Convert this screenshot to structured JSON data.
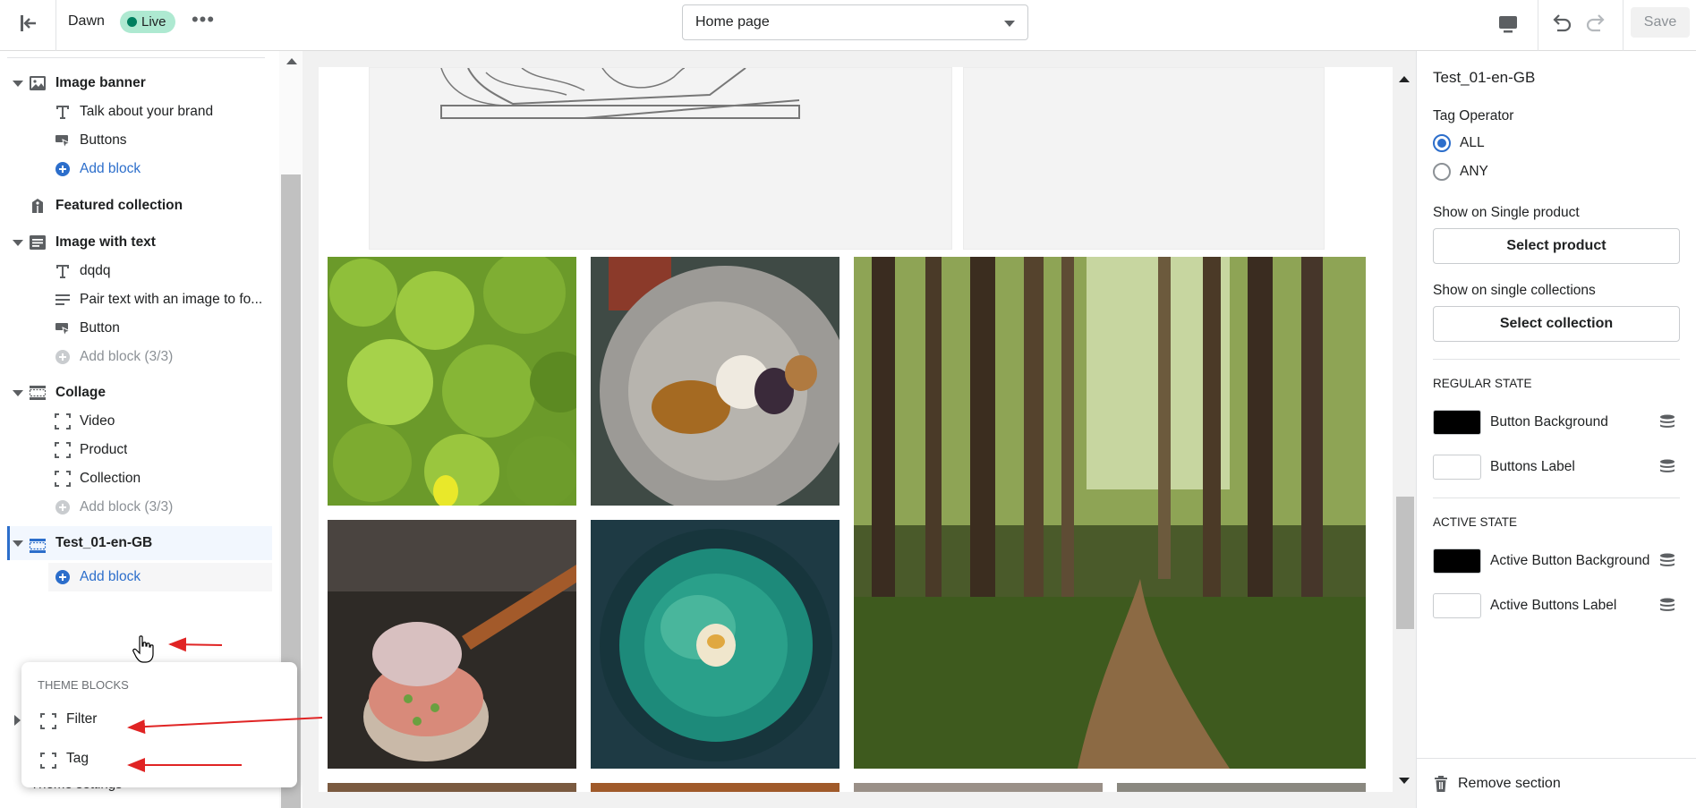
{
  "topbar": {
    "theme_name": "Dawn",
    "live_badge": "Live",
    "page_selector": "Home page",
    "save_label": "Save"
  },
  "sidebar": {
    "rows": [
      {
        "kind": "section",
        "label": "Image banner",
        "icon": "image-icon",
        "caret": "down"
      },
      {
        "kind": "block",
        "label": "Talk about your brand",
        "icon": "text-icon"
      },
      {
        "kind": "block",
        "label": "Buttons",
        "icon": "button-icon"
      },
      {
        "kind": "add",
        "label": "Add block",
        "icon": "plus-circle-icon"
      },
      {
        "kind": "section",
        "label": "Featured collection",
        "icon": "tag-icon",
        "caret": "none"
      },
      {
        "kind": "section",
        "label": "Image with text",
        "icon": "image-text-icon",
        "caret": "down"
      },
      {
        "kind": "block",
        "label": "dqdq",
        "icon": "text-icon"
      },
      {
        "kind": "block",
        "label": "Pair text with an image to fo...",
        "icon": "paragraph-icon"
      },
      {
        "kind": "block",
        "label": "Button",
        "icon": "button-icon"
      },
      {
        "kind": "add-disabled",
        "label": "Add block (3/3)",
        "icon": "plus-circle-icon"
      },
      {
        "kind": "section",
        "label": "Collage",
        "icon": "collage-icon",
        "caret": "down"
      },
      {
        "kind": "block",
        "label": "Video",
        "icon": "block-frame-icon"
      },
      {
        "kind": "block",
        "label": "Product",
        "icon": "block-frame-icon"
      },
      {
        "kind": "block",
        "label": "Collection",
        "icon": "block-frame-icon"
      },
      {
        "kind": "add-disabled",
        "label": "Add block (3/3)",
        "icon": "plus-circle-icon"
      },
      {
        "kind": "section-selected",
        "label": "Test_01-en-GB",
        "icon": "app-section-icon",
        "caret": "down"
      },
      {
        "kind": "add-hover",
        "label": "Add block",
        "icon": "plus-circle-icon"
      }
    ],
    "behind_popover_text": "Theme settings"
  },
  "popover": {
    "title": "THEME BLOCKS",
    "items": [
      {
        "label": "Filter",
        "icon": "block-frame-icon"
      },
      {
        "label": "Tag",
        "icon": "block-frame-icon"
      }
    ]
  },
  "settings": {
    "title": "Test_01-en-GB",
    "tag_operator_label": "Tag Operator",
    "tag_operator_options": [
      {
        "label": "ALL",
        "selected": true
      },
      {
        "label": "ANY",
        "selected": false
      }
    ],
    "single_product_label": "Show on Single product",
    "select_product_button": "Select product",
    "single_collections_label": "Show on single collections",
    "select_collection_button": "Select collection",
    "regular_state_heading": "REGULAR STATE",
    "regular_colors": [
      {
        "label": "Button Background",
        "color": "#000000"
      },
      {
        "label": "Buttons Label",
        "color": "#ffffff"
      }
    ],
    "active_state_heading": "ACTIVE STATE",
    "active_colors": [
      {
        "label": "Active Button Background",
        "color": "#000000"
      },
      {
        "label": "Active Buttons Label",
        "color": "#ffffff"
      }
    ],
    "remove_section_label": "Remove section"
  },
  "colors": {
    "accent_blue": "#2c6ecb",
    "live_green": "#aee9d1",
    "annotation_red": "#e02424"
  }
}
